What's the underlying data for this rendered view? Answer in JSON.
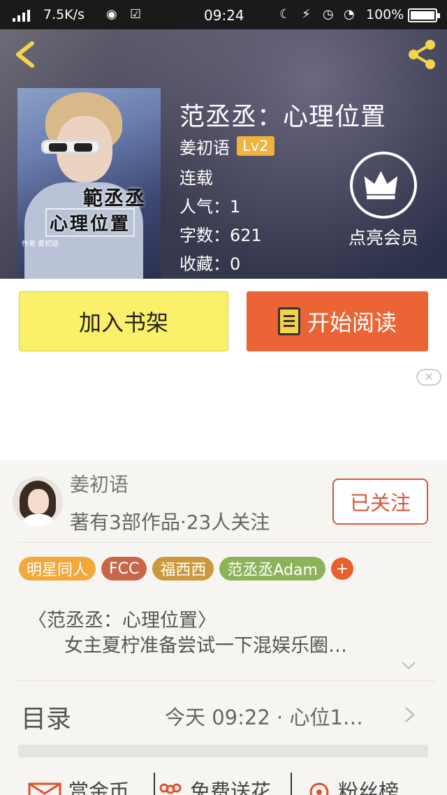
{
  "status_bar": {
    "speed": "7.5K/s",
    "time": "09:24",
    "battery": "100%",
    "icons": [
      "signal-icon",
      "weibo-icon",
      "wechat-icon",
      "clipboard-check-icon",
      "moon-icon",
      "charging-icon",
      "alarm-icon",
      "wifi-icon",
      "battery-icon"
    ]
  },
  "header": {
    "back_icon": "back-chevron-icon",
    "share_icon": "share-icon",
    "cover": {
      "title_line1": "範丞丞",
      "title_line2": "心理位置",
      "byline": "作者 姜初語"
    },
    "book_title": "范丞丞：心理位置",
    "author": "姜初语",
    "level": "Lv2",
    "status": "连载",
    "popularity": "人气：1",
    "word_count": "字数：621",
    "favorites": "收藏：0",
    "vip_label": "点亮会员",
    "vip_icon": "crown-icon"
  },
  "actions": {
    "add_shelf": "加入书架",
    "start_reading": "开始阅读"
  },
  "ad": {
    "close_label": "✕"
  },
  "author_card": {
    "name": "姜初语",
    "works": "著有3部作品·23人关注",
    "follow_label": "已关注"
  },
  "tags": [
    {
      "label": "明星同人",
      "color": "#f2a83a"
    },
    {
      "label": "FCC",
      "color": "#c8664a"
    },
    {
      "label": "福西西",
      "color": "#c99a3c"
    },
    {
      "label": "范丞丞Adam",
      "color": "#8db35a"
    }
  ],
  "tag_add_label": "+",
  "intro": {
    "line1": "〈范丞丞：心理位置〉",
    "line2": "女主夏柠准备尝试一下混娱乐圈…"
  },
  "toc": {
    "label": "目录",
    "latest": "今天 09:22 · 心位1…"
  },
  "bottom_bar": {
    "reward": "赏金币",
    "flowers": "免费送花",
    "fans": "粉丝榜"
  },
  "colors": {
    "accent_orange": "#ea6435",
    "shelf_yellow": "#faf06a",
    "level_badge": "#f0b43c",
    "follow_red": "#d9563a"
  }
}
